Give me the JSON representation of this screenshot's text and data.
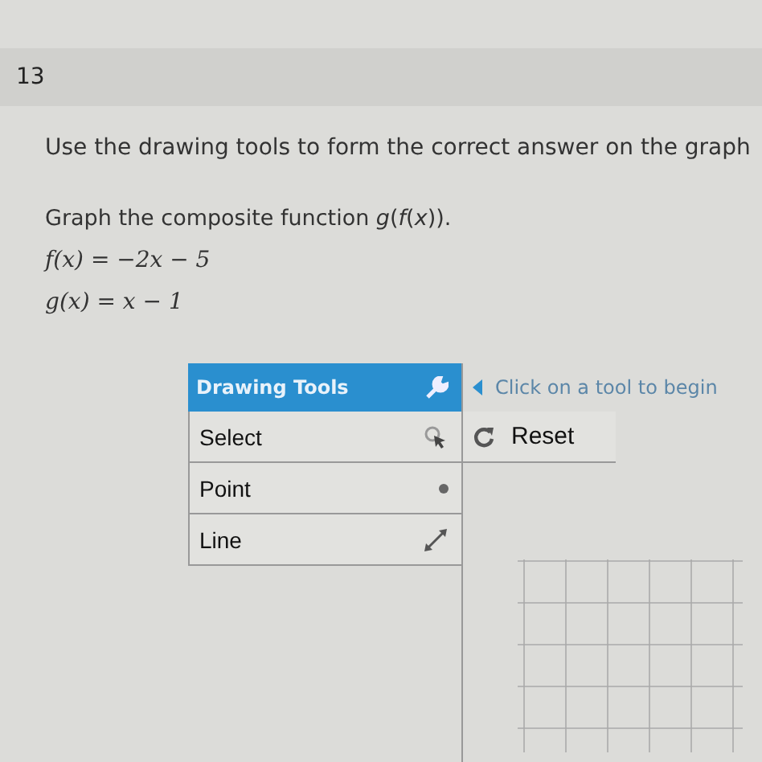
{
  "question": {
    "number": "13",
    "instruction": "Use the drawing tools to form the correct answer on the graph",
    "prompt": "Graph the composite function *g*(*f*(*x*)).",
    "equations": [
      "f(x) = −2x − 5",
      "g(x) = x − 1"
    ]
  },
  "drawing_tools": {
    "title": "Drawing Tools",
    "tools": [
      {
        "label": "Select",
        "kind": "select"
      },
      {
        "label": "Point",
        "kind": "point"
      },
      {
        "label": "Line",
        "kind": "line"
      }
    ]
  },
  "canvas": {
    "hint": "Click on a tool to begin",
    "reset": "Reset"
  }
}
